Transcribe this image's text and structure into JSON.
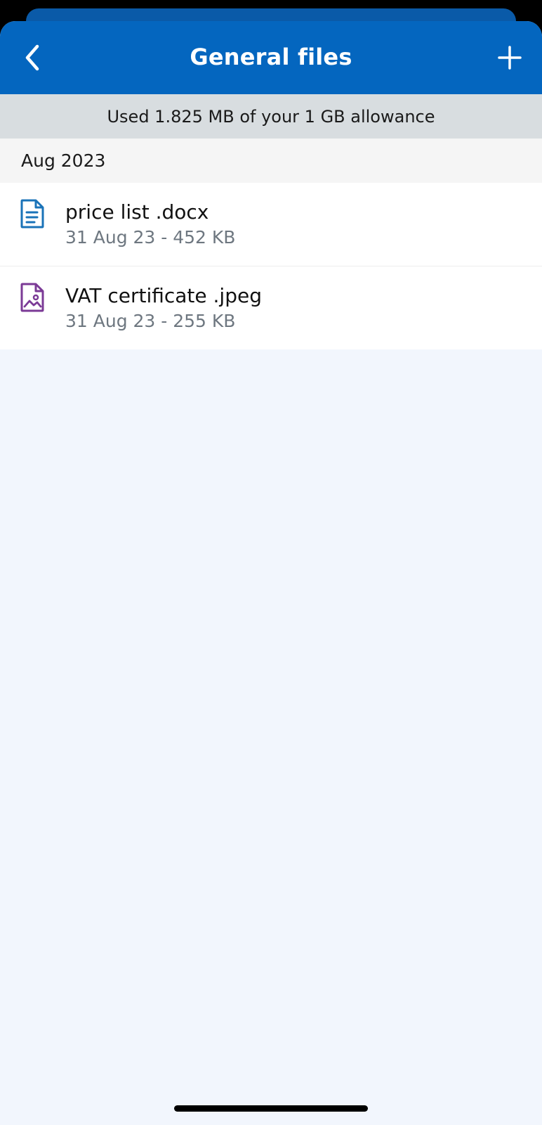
{
  "header": {
    "title": "General files",
    "back_icon": "chevron-left-icon",
    "add_icon": "plus-icon"
  },
  "storage": {
    "allowance_text": "Used 1.825 MB of your 1 GB allowance"
  },
  "sections": [
    {
      "label": "Aug 2023",
      "files": [
        {
          "name": "price list .docx",
          "meta": "31 Aug 23 - 452 KB",
          "icon": "document-icon",
          "icon_color": "#1a73b8"
        },
        {
          "name": "VAT certificate .jpeg",
          "meta": "31 Aug 23 - 255 KB",
          "icon": "image-file-icon",
          "icon_color": "#7b3a96"
        }
      ]
    }
  ],
  "colors": {
    "header_bg": "#0466bf",
    "allowance_bg": "#d8dde0",
    "section_bg": "#f5f5f5",
    "page_bg": "#f2f6fd",
    "meta_text": "#6e7780"
  }
}
